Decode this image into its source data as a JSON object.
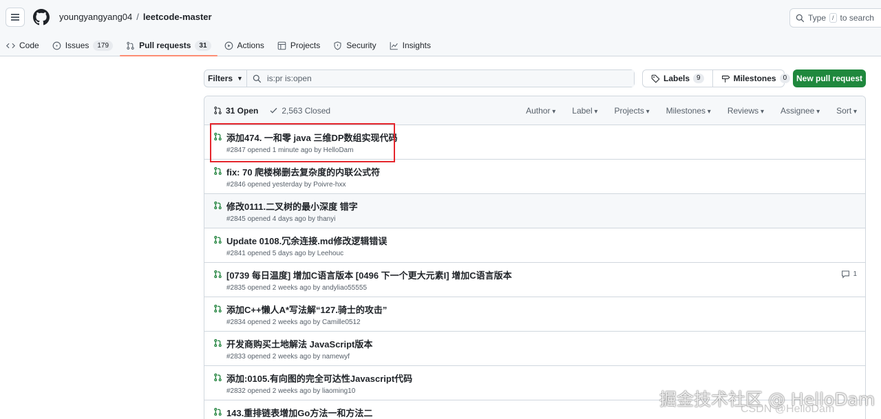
{
  "header": {
    "owner": "youngyangyang04",
    "separator": "/",
    "repo": "leetcode-master",
    "search_type": "Type",
    "search_key": "/",
    "search_rest": "to search"
  },
  "tabs": [
    {
      "label": "Code",
      "icon": "code-icon"
    },
    {
      "label": "Issues",
      "icon": "issue-icon",
      "count": "179"
    },
    {
      "label": "Pull requests",
      "icon": "git-pull-request-icon",
      "count": "31",
      "active": true
    },
    {
      "label": "Actions",
      "icon": "play-icon"
    },
    {
      "label": "Projects",
      "icon": "table-icon"
    },
    {
      "label": "Security",
      "icon": "shield-icon"
    },
    {
      "label": "Insights",
      "icon": "graph-icon"
    }
  ],
  "subnav": {
    "filters_label": "Filters",
    "query": "is:pr is:open",
    "labels_label": "Labels",
    "labels_count": "9",
    "milestones_label": "Milestones",
    "milestones_count": "0",
    "new_pr_label": "New pull request"
  },
  "list": {
    "open_label": "31 Open",
    "closed_label": "2,563 Closed",
    "sorts": [
      "Author",
      "Label",
      "Projects",
      "Milestones",
      "Reviews",
      "Assignee",
      "Sort"
    ],
    "rows": [
      {
        "title": "添加474. 一和零 java 三维DP数组实现代码",
        "meta": "#2847 opened 1 minute ago by HelloDam"
      },
      {
        "title": "fix: 70 爬楼梯删去复杂度的内联公式符",
        "meta": "#2846 opened yesterday by Poivre-hxx"
      },
      {
        "title": "修改0111.二叉树的最小深度 错字",
        "meta": "#2845 opened 4 days ago by thanyi"
      },
      {
        "title": "Update 0108.冗余连接.md修改逻辑错误",
        "meta": "#2841 opened 5 days ago by Leehouc"
      },
      {
        "title": "[0739 每日温度] 增加C语言版本 [0496 下一个更大元素I] 增加C语言版本",
        "meta": "#2835 opened 2 weeks ago by andyliao55555",
        "comments": "1"
      },
      {
        "title": "添加C++懒人A*写法解“127.骑士的攻击”",
        "meta": "#2834 opened 2 weeks ago by Camille0512"
      },
      {
        "title": "开发商购买土地解法 JavaScript版本",
        "meta": "#2833 opened 2 weeks ago by namewyf"
      },
      {
        "title": "添加:0105.有向图的完全可达性Javascript代码",
        "meta": "#2832 opened 2 weeks ago by liaoming10"
      },
      {
        "title": "143.重排链表增加Go方法一和方法二",
        "meta": ""
      }
    ]
  },
  "watermark": {
    "main": "掘金技术社区 @ HelloDam",
    "secondary": "CSDN @HelloDam"
  },
  "colors": {
    "accent": "#fd8c73",
    "open_green": "#1a7f37",
    "button_green": "#1f883d",
    "highlight_red": "#e5252c"
  }
}
